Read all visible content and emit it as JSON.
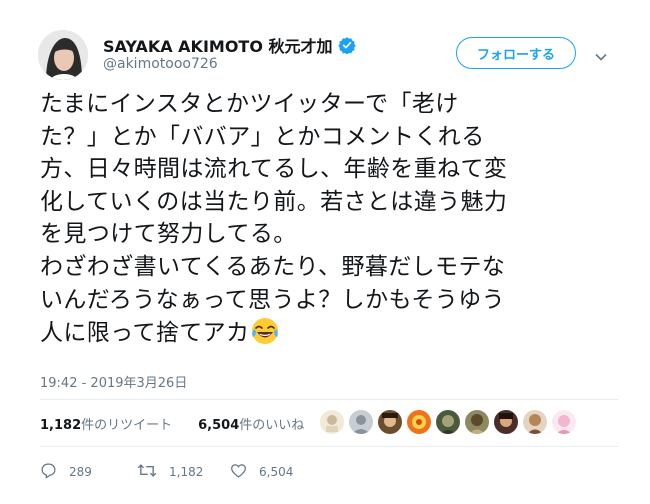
{
  "user": {
    "display_name": "SAYAKA AKIMOTO 秋元才加",
    "handle": "@akimotooo726",
    "verified_icon": "verified-badge-icon"
  },
  "follow_button": {
    "label": "フォローする"
  },
  "tweet": {
    "lines": [
      "たまにインスタとかツイッターで「老け",
      "た？」とか「ババア」とかコメントくれる",
      "方、日々時間は流れてるし、年齢を重ねて変",
      "化していくのは当たり前。若さとは違う魅力",
      "を見つけて努力してる。",
      "わざわざ書いてくるあたり、野暮だしモテな",
      "いんだろうなぁって思うよ？しかもそうゆう",
      "人に限って捨てアカ"
    ],
    "emoji": "face-with-tears-of-joy",
    "timestamp": "19:42 - 2019年3月26日"
  },
  "stats": {
    "retweets_count": "1,182",
    "retweets_label": "件のリツイート",
    "likes_count": "6,504",
    "likes_label": "件のいいね"
  },
  "actions": {
    "reply_count": "289",
    "retweet_count": "1,182",
    "like_count": "6,504"
  },
  "colors": {
    "accent": "#1da1f2",
    "text": "#14171a",
    "muted": "#657786",
    "divider": "#e6ecf0"
  }
}
